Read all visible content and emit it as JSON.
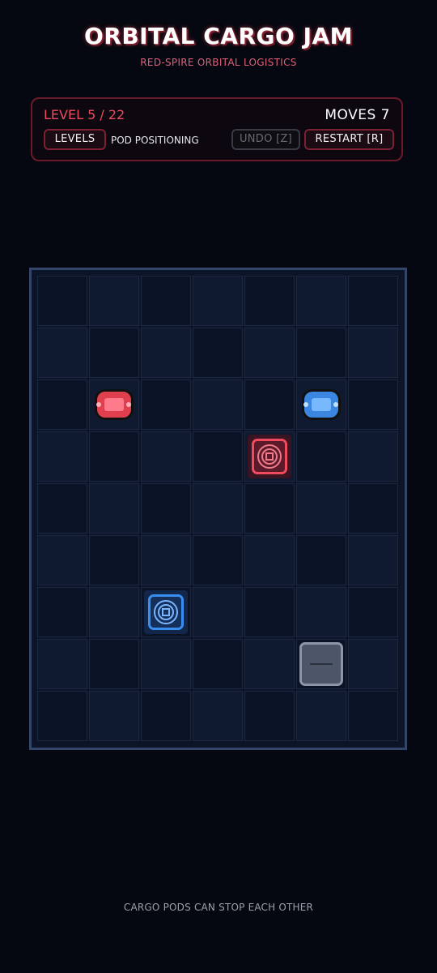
{
  "header": {
    "title": "ORBITAL CARGO JAM",
    "subtitle": "RED-SPIRE ORBITAL LOGISTICS"
  },
  "hud": {
    "level": "LEVEL 5 / 22",
    "moves": "MOVES  7",
    "levels_label": "LEVELS",
    "puzzle_name": "POD POSITIONING",
    "undo_label": "UNDO [Z]",
    "restart_label": "RESTART  [R]"
  },
  "board": {
    "cols": 7,
    "rows": 9,
    "pods": [
      {
        "name": "red-cargo-pod",
        "color": "red",
        "col": 1,
        "row": 2
      },
      {
        "name": "blue-cargo-pod",
        "color": "blue",
        "col": 5,
        "row": 2
      }
    ],
    "targets": [
      {
        "name": "red-target-pad",
        "color": "red",
        "col": 4,
        "row": 3
      },
      {
        "name": "blue-target-pad",
        "color": "blue",
        "col": 2,
        "row": 6
      }
    ],
    "blocks": [
      {
        "name": "fixed-block",
        "col": 5,
        "row": 7
      }
    ]
  },
  "footer": {
    "hint": "CARGO PODS CAN STOP EACH OTHER"
  },
  "colors": {
    "accent_red": "#ef4a60",
    "accent_blue": "#3a8ef0",
    "background": "#050810",
    "board_border": "#34456a"
  }
}
